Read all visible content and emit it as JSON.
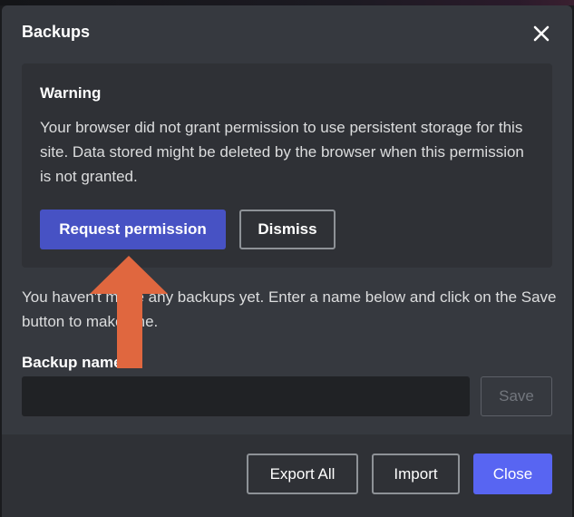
{
  "dialog": {
    "title": "Backups",
    "close_icon": "close-icon"
  },
  "warning": {
    "title": "Warning",
    "message": "Your browser did not grant permission to use persistent storage for this site. Data stored might be deleted by the browser when this permission is not granted.",
    "request_label": "Request permission",
    "dismiss_label": "Dismiss"
  },
  "backups": {
    "empty_message": "You haven't made any backups yet. Enter a name below and click on the Save button to make one.",
    "name_label": "Backup name",
    "name_value": "",
    "save_label": "Save"
  },
  "footer": {
    "export_label": "Export All",
    "import_label": "Import",
    "close_label": "Close"
  },
  "annotation": {
    "icon": "up-arrow-icon",
    "color": "#e0673f"
  },
  "colors": {
    "primary": "#5865f2",
    "primary_dark": "#4752c4",
    "surface": "#36393f",
    "surface_dark": "#2f3136"
  }
}
